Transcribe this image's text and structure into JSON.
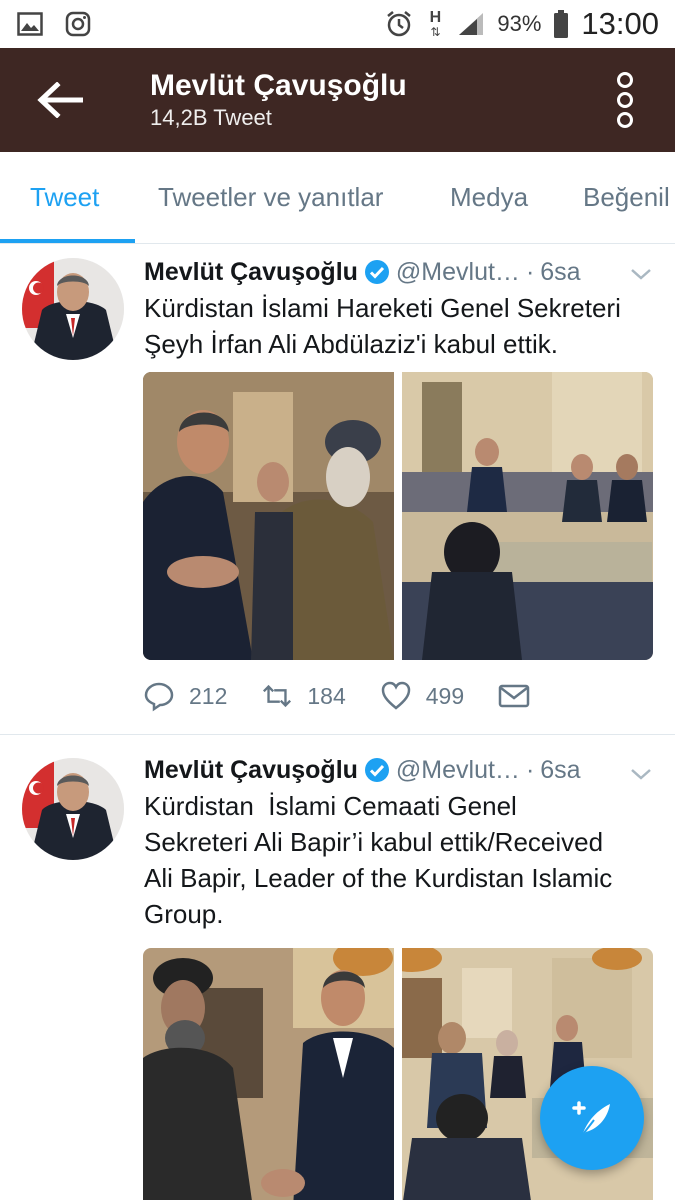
{
  "status_bar": {
    "battery": "93%",
    "clock": "13:00",
    "network": "H",
    "icons": [
      "image-icon",
      "instagram-icon",
      "alarm-icon",
      "signal-icon",
      "battery-icon"
    ]
  },
  "app_bar": {
    "title": "Mevlüt Çavuşoğlu",
    "subtitle": "14,2B Tweet"
  },
  "tabs": [
    {
      "label": "Tweet",
      "active": true
    },
    {
      "label": "Tweetler ve yanıtlar",
      "active": false
    },
    {
      "label": "Medya",
      "active": false
    },
    {
      "label": "Beğenil",
      "active": false
    }
  ],
  "tweets": [
    {
      "name": "Mevlüt Çavuşoğlu",
      "handle": "@Mevlut…",
      "dot": "·",
      "time": "6sa",
      "text_lines": [
        "Kürdistan İslami Hareketi Genel Sekreteri",
        "Şeyh İrfan Ali Abdülaziz'i kabul ettik."
      ],
      "replies": "212",
      "retweets": "184",
      "likes": "499"
    },
    {
      "name": "Mevlüt Çavuşoğlu",
      "handle": "@Mevlut…",
      "dot": "·",
      "time": "6sa",
      "text_lines": [
        "Kürdistan  İslami Cemaati Genel",
        "Sekreteri Ali Bapir’i kabul ettik/Received",
        "Ali Bapir, Leader of the Kurdistan Islamic",
        "Group."
      ]
    }
  ],
  "colors": {
    "app_bar": "#3e2723",
    "accent": "#1da1f2",
    "secondary_text": "#657786"
  }
}
